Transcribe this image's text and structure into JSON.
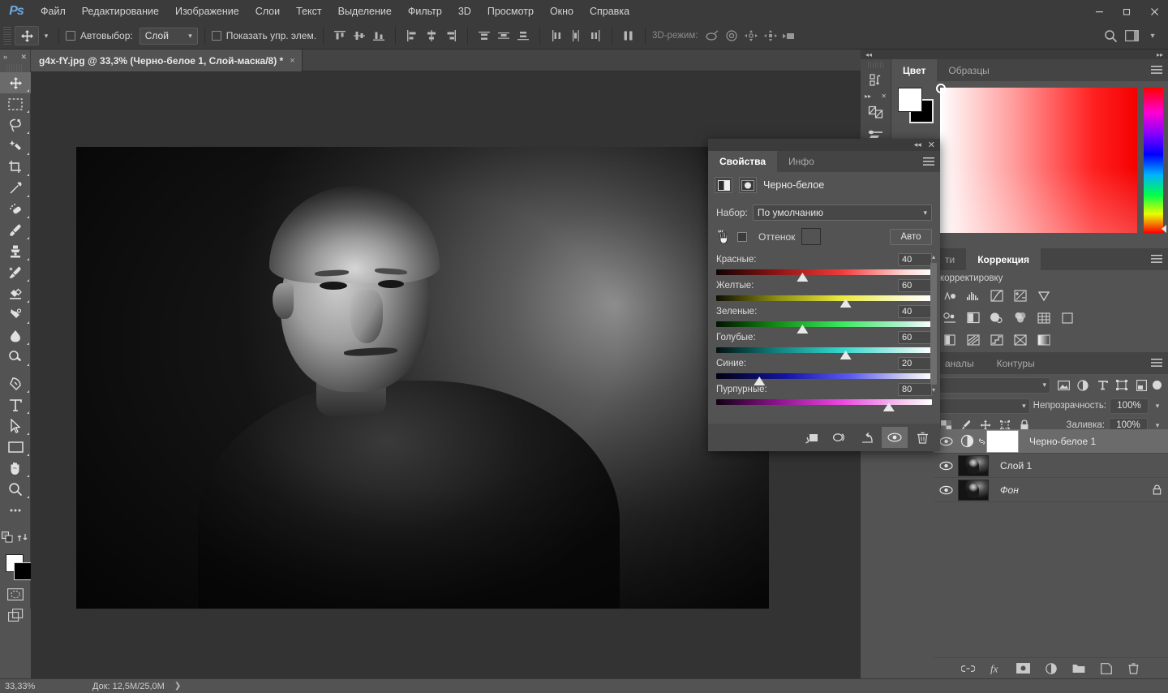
{
  "app": {
    "logo": "Ps"
  },
  "menu": {
    "items": [
      "Файл",
      "Редактирование",
      "Изображение",
      "Слои",
      "Текст",
      "Выделение",
      "Фильтр",
      "3D",
      "Просмотр",
      "Окно",
      "Справка"
    ],
    "window_controls": {
      "minimize": "minimize-icon",
      "maximize": "maximize-icon",
      "close": "close-icon"
    }
  },
  "options_bar": {
    "tool_icon": "move-tool-icon",
    "auto_select_label": "Автовыбор:",
    "auto_select_value": "Слой",
    "show_controls_label": "Показать упр. элем.",
    "three_d_label": "3D-режим:",
    "align_icons": [
      "align-top-edges-icon",
      "align-vertical-centers-icon",
      "align-bottom-edges-icon",
      "align-left-edges-icon",
      "align-horizontal-centers-icon",
      "align-right-edges-icon"
    ],
    "distribute_icons": [
      "distribute-top-icon",
      "distribute-vertical-center-icon",
      "distribute-bottom-icon",
      "distribute-left-icon",
      "distribute-horizontal-center-icon",
      "distribute-right-icon",
      "distribute-spacing-icon"
    ],
    "threed_icons": [
      "orbit-3d-icon",
      "roll-3d-icon",
      "pan-3d-icon",
      "slide-3d-icon",
      "camera-3d-icon"
    ],
    "right_icons": [
      "search-icon",
      "workspace-icon",
      "chevron-down-icon"
    ]
  },
  "toolbar": {
    "tools": [
      {
        "name": "move-tool",
        "active": true
      },
      {
        "name": "rectangular-marquee-tool",
        "active": false
      },
      {
        "name": "lasso-tool",
        "active": false
      },
      {
        "name": "quick-selection-tool",
        "active": false
      },
      {
        "name": "crop-tool",
        "active": false
      },
      {
        "name": "eyedropper-tool",
        "active": false
      },
      {
        "name": "spot-healing-brush-tool",
        "active": false
      },
      {
        "name": "brush-tool",
        "active": false
      },
      {
        "name": "clone-stamp-tool",
        "active": false
      },
      {
        "name": "history-brush-tool",
        "active": false
      },
      {
        "name": "eraser-tool",
        "active": false
      },
      {
        "name": "gradient-tool",
        "active": false
      },
      {
        "name": "blur-tool",
        "active": false
      },
      {
        "name": "dodge-tool",
        "active": false
      },
      {
        "name": "pen-tool",
        "active": false
      },
      {
        "name": "type-tool",
        "active": false
      },
      {
        "name": "path-selection-tool",
        "active": false
      },
      {
        "name": "rectangle-tool",
        "active": false
      },
      {
        "name": "hand-tool",
        "active": false
      },
      {
        "name": "zoom-tool",
        "active": false
      },
      {
        "name": "more-tools",
        "active": false
      }
    ],
    "foreground_color": "#ffffff",
    "background_color": "#000000",
    "quick_mask": "quick-mask-icon",
    "screen_mode": "screen-mode-icon"
  },
  "document": {
    "tab_title": "g4x-fY.jpg @ 33,3% (Черно-белое 1, Слой-маска/8) *",
    "close": "×"
  },
  "status_bar": {
    "zoom": "33,33%",
    "doc_info": "Док: 12,5M/25,0M",
    "caret": "❯"
  },
  "color_panel": {
    "tabs": [
      {
        "label": "Цвет",
        "active": true
      },
      {
        "label": "Образцы",
        "active": false
      }
    ],
    "menu_icon": "panel-menu-icon",
    "foreground_color": "#ffffff",
    "background_color": "#000000"
  },
  "adjustments_panel": {
    "tabs": [
      {
        "label": "ти",
        "active": false
      },
      {
        "label": "Коррекция",
        "active": true
      }
    ],
    "menu_icon": "panel-menu-icon",
    "hint": "корректировку",
    "rows": [
      [
        "brightness-contrast-icon",
        "levels-icon",
        "curves-icon",
        "exposure-icon",
        "vibrance-icon"
      ],
      [
        "hue-saturation-icon",
        "color-balance-icon",
        "black-and-white-icon",
        "photo-filter-icon",
        "channel-mixer-icon",
        "color-lookup-icon"
      ],
      [
        "invert-icon",
        "posterize-icon",
        "threshold-icon",
        "selective-color-icon",
        "gradient-map-icon"
      ]
    ]
  },
  "layers_panel": {
    "tabs": [
      {
        "label": "аналы",
        "active": false
      },
      {
        "label": "Контуры",
        "active": false
      }
    ],
    "menu_icon": "panel-menu-icon",
    "filter_icons": [
      "filter-image-icon",
      "filter-adjustment-icon",
      "filter-type-icon",
      "filter-shape-icon",
      "filter-smart-object-icon"
    ],
    "opacity_label": "Непрозрачность:",
    "opacity_value": "100%",
    "fill_label": "Заливка:",
    "fill_value": "100%",
    "lock_icons": [
      "lock-transparent-pixels-icon",
      "lock-image-pixels-icon",
      "lock-position-icon",
      "lock-artboard-icon",
      "lock-all-icon"
    ],
    "layers": [
      {
        "name": "Черно-белое 1",
        "type": "adjustment",
        "selected": true,
        "visible": true,
        "locked": false,
        "linked": true
      },
      {
        "name": "Слой 1",
        "type": "pixel",
        "selected": false,
        "visible": true,
        "locked": false,
        "linked": false
      },
      {
        "name": "Фон",
        "type": "background",
        "selected": false,
        "visible": true,
        "locked": true,
        "linked": false
      }
    ],
    "footer_icons": [
      "link-layers-icon",
      "add-layer-style-icon",
      "add-layer-mask-icon",
      "new-fill-adjustment-layer-icon",
      "new-group-icon",
      "new-layer-icon",
      "delete-layer-icon"
    ]
  },
  "properties_panel": {
    "tabs": [
      {
        "label": "Свойства",
        "active": true
      },
      {
        "label": "Инфо",
        "active": false
      }
    ],
    "menu_icon": "panel-menu-icon",
    "collapse_icon": "collapse-icon",
    "close_icon": "close-icon",
    "adjustment_title": "Черно-белое",
    "head_icons": [
      "black-and-white-adjustment-icon",
      "clip-to-layer-icon"
    ],
    "preset_label": "Набор:",
    "preset_value": "По умолчанию",
    "tint_label": "Оттенок",
    "tint_color": "#535353",
    "auto_label": "Авто",
    "hand_cursor": "hand-cursor-icon",
    "sliders": [
      {
        "label": "Красные:",
        "value": "40",
        "percent": 40,
        "gradient": "linear-gradient(to right,#120303 0%,#8c1414 28%,#f03a3a 58%,#ffd9d9 88%,#ffffff 100%)"
      },
      {
        "label": "Желтые:",
        "value": "60",
        "percent": 60,
        "gradient": "linear-gradient(to right,#0e0e02 0%,#8d8d12 28%,#e9e93c 58%,#fbfbd0 88%,#ffffff 100%)"
      },
      {
        "label": "Зеленые:",
        "value": "40",
        "percent": 40,
        "gradient": "linear-gradient(to right,#021202 0%,#128c12 28%,#3ae85e 58%,#b8f2d6 88%,#ffffff 100%)"
      },
      {
        "label": "Голубые:",
        "value": "60",
        "percent": 60,
        "gradient": "linear-gradient(to right,#021010 0%,#12807f 28%,#33d6cb 58%,#c3f1ed 88%,#ffffff 100%)"
      },
      {
        "label": "Синие:",
        "value": "20",
        "percent": 20,
        "gradient": "linear-gradient(to right,#010110 0%,#1414a0 32%,#5b5bf0 62%,#cfcfef 88%,#ffffff 100%)"
      },
      {
        "label": "Пурпурные:",
        "value": "80",
        "percent": 80,
        "gradient": "linear-gradient(to right,#110211 0%,#8c128c 28%,#e848e0 58%,#f5cef0 88%,#ffffff 100%)"
      }
    ],
    "footer_icons": [
      "clip-to-layer-icon",
      "toggle-previous-state-icon",
      "reset-icon",
      "toggle-visibility-icon",
      "delete-adjustment-icon"
    ]
  }
}
